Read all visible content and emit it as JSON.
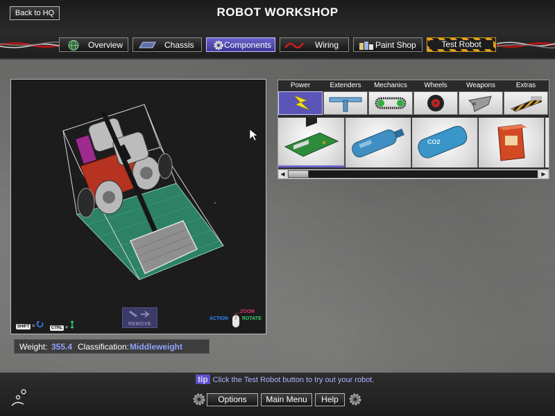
{
  "header": {
    "title": "ROBOT WORKSHOP",
    "back_label": "Back to HQ"
  },
  "tabs": [
    {
      "label": "Overview",
      "icon": "globe-icon",
      "active": false
    },
    {
      "label": "Chassis",
      "icon": "chassis-icon",
      "active": false
    },
    {
      "label": "Components",
      "icon": "gear-icon",
      "active": true
    },
    {
      "label": "Wiring",
      "icon": "wire-icon",
      "active": false
    },
    {
      "label": "Paint Shop",
      "icon": "paint-cans-icon",
      "active": false
    },
    {
      "label": "Test Robot",
      "icon": "",
      "active": false
    }
  ],
  "viewport": {
    "shift_key": "SHIFT",
    "ctrl_key": "CTRL",
    "remove_label": "REMOVE",
    "zoom_label": "ZOOM",
    "action_label": "ACTION",
    "rotate_label": "ROTATE"
  },
  "stats": {
    "weight_label": "Weight:",
    "weight_value": "355.4",
    "class_label": "Classification:",
    "class_value": "Middleweight"
  },
  "parts": {
    "categories": [
      {
        "label": "Power",
        "icon": "lightning-icon",
        "active": true
      },
      {
        "label": "Extenders",
        "icon": "extender-bar-icon",
        "active": false
      },
      {
        "label": "Mechanics",
        "icon": "chain-belt-icon",
        "active": false
      },
      {
        "label": "Wheels",
        "icon": "wheel-icon",
        "active": false
      },
      {
        "label": "Weapons",
        "icon": "blade-icon",
        "active": false
      },
      {
        "label": "Extras",
        "icon": "wedge-icon",
        "active": false
      }
    ],
    "items": [
      {
        "icon": "circuit-board-icon",
        "selected": true
      },
      {
        "icon": "blue-tank-icon",
        "selected": false
      },
      {
        "icon": "co2-tank-icon",
        "label": "CO2",
        "selected": false
      },
      {
        "icon": "battery-box-icon",
        "selected": false
      }
    ]
  },
  "footer": {
    "tip_badge": "tip",
    "tip_text": "Click the Test Robot button to try out your robot.",
    "options_label": "Options",
    "main_menu_label": "Main Menu",
    "help_label": "Help"
  },
  "colors": {
    "accent": "#6b63c9",
    "stat_value": "#8fa3ff",
    "hazard": "#e0a020",
    "floor_green": "#2f8d6e"
  }
}
